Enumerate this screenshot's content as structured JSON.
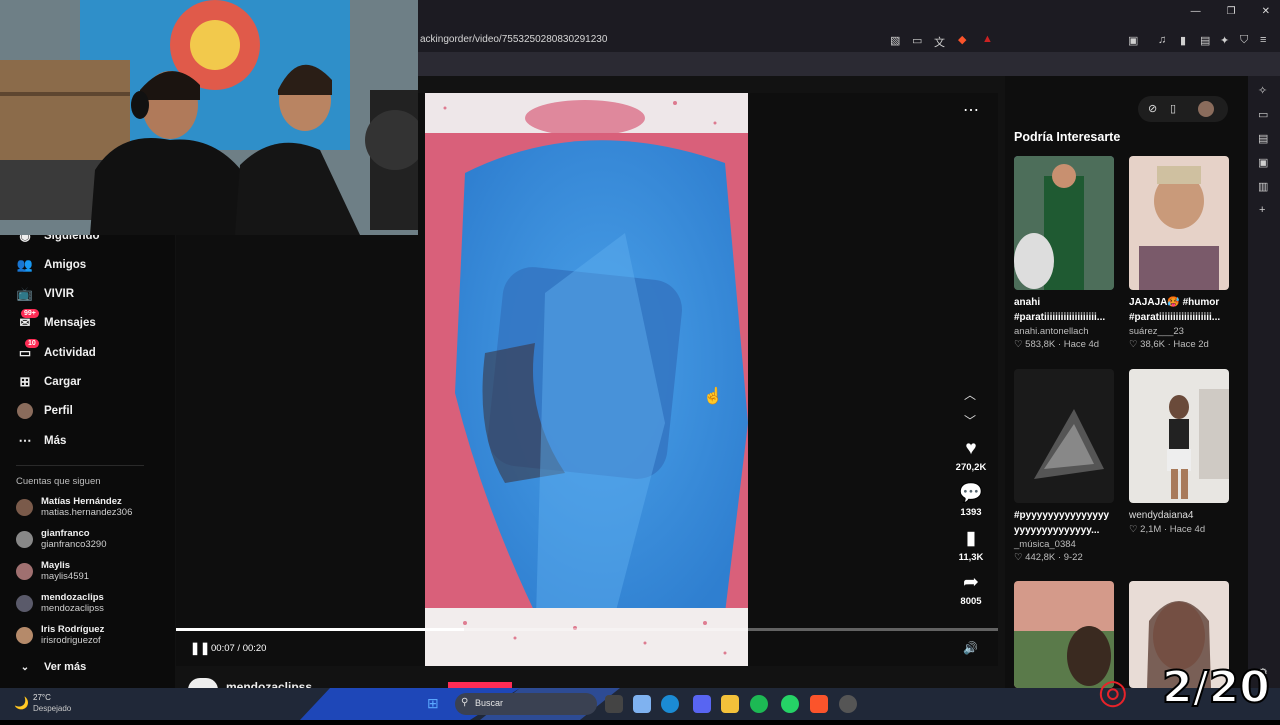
{
  "browser": {
    "url": "ackingorder/video/7553250280830291230"
  },
  "sidebar": {
    "items": [
      {
        "label": "Siguiendo",
        "icon": "following-icon"
      },
      {
        "label": "Amigos",
        "icon": "friends-icon"
      },
      {
        "label": "VIVIR",
        "icon": "live-icon"
      },
      {
        "label": "Mensajes",
        "icon": "messages-icon",
        "badge": "99+"
      },
      {
        "label": "Actividad",
        "icon": "activity-icon",
        "badge": "10"
      },
      {
        "label": "Cargar",
        "icon": "upload-icon"
      },
      {
        "label": "Perfil",
        "icon": "profile-icon"
      },
      {
        "label": "Más",
        "icon": "more-icon"
      }
    ],
    "following_title": "Cuentas que siguen",
    "accounts": [
      {
        "name": "Matías Hernández",
        "handle": "matias.hernandez306"
      },
      {
        "name": "gianfranco",
        "handle": "gianfranco3290"
      },
      {
        "name": "Maylis",
        "handle": "maylis4591"
      },
      {
        "name": "mendozaclips",
        "handle": "mendozaclipss"
      },
      {
        "name": "Iris Rodríguez",
        "handle": "irisrodriguezof"
      }
    ],
    "see_more": "Ver más"
  },
  "player": {
    "time": "00:07 / 00:20",
    "progress": 0.35,
    "channel": "mendozaclipss",
    "likes": "270,2K",
    "comments": "1393",
    "saves": "11,3K",
    "shares": "8005"
  },
  "suggested": {
    "title": "Podría Interesarte",
    "cards": [
      {
        "title1": "anahi",
        "title2": "#paratiiiiiiiiiiiiiiiiiii...",
        "author": "anahi.antonellach",
        "stats": "♡ 583,8K · Hace 4d"
      },
      {
        "title1": "JAJAJA🥵 #humor",
        "title2": "#paratiiiiiiiiiiiiiiiiiii...",
        "author": "suárez___23",
        "stats": "♡ 38,6K · Hace 2d"
      },
      {
        "title1": "#pyyyyyyyyyyyyyyy",
        "title2": "yyyyyyyyyyyyyy...",
        "author": "_música_0384",
        "stats": "♡ 442,8K · 9-22"
      },
      {
        "title1": "wendydaiana4",
        "title2": "",
        "author": "",
        "stats": "♡ 2,1M · Hace 4d"
      }
    ]
  },
  "taskbar": {
    "temp": "27°C",
    "weather": "Despejado",
    "search": "Buscar"
  },
  "overlay": {
    "counter": "2/20"
  },
  "colors": {
    "accent": "#fe2c55",
    "video_blue": "#3b8fd8",
    "video_pink": "#e0627a"
  }
}
